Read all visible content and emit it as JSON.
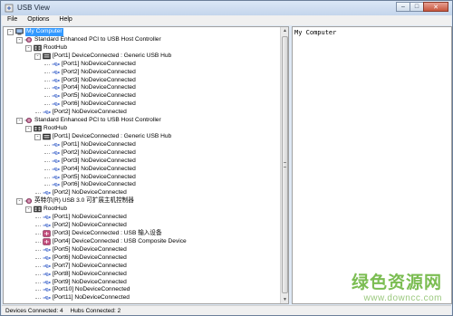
{
  "window": {
    "title": "USB View",
    "buttons": {
      "minimize": "–",
      "maximize": "□",
      "close": "✕"
    }
  },
  "menu": [
    "File",
    "Options",
    "Help"
  ],
  "tree": [
    {
      "level": 0,
      "type": "computer",
      "label": "My Computer",
      "expander": "-",
      "selected": true
    },
    {
      "level": 1,
      "type": "controller",
      "label": "Standard Enhanced PCI to USB Host Controller",
      "expander": "-"
    },
    {
      "level": 2,
      "type": "roothub",
      "label": "RootHub",
      "expander": "-"
    },
    {
      "level": 3,
      "type": "hub",
      "label": "[Port1] DeviceConnected : Generic USB Hub",
      "expander": "-"
    },
    {
      "level": 4,
      "type": "port",
      "label": "[Port1] NoDeviceConnected"
    },
    {
      "level": 4,
      "type": "port",
      "label": "[Port2] NoDeviceConnected"
    },
    {
      "level": 4,
      "type": "port",
      "label": "[Port3] NoDeviceConnected"
    },
    {
      "level": 4,
      "type": "port",
      "label": "[Port4] NoDeviceConnected"
    },
    {
      "level": 4,
      "type": "port",
      "label": "[Port5] NoDeviceConnected"
    },
    {
      "level": 4,
      "type": "port",
      "label": "[Port6] NoDeviceConnected"
    },
    {
      "level": 3,
      "type": "port",
      "label": "[Port2] NoDeviceConnected"
    },
    {
      "level": 1,
      "type": "controller",
      "label": "Standard Enhanced PCI to USB Host Controller",
      "expander": "-"
    },
    {
      "level": 2,
      "type": "roothub",
      "label": "RootHub",
      "expander": "-"
    },
    {
      "level": 3,
      "type": "hub",
      "label": "[Port1] DeviceConnected : Generic USB Hub",
      "expander": "-"
    },
    {
      "level": 4,
      "type": "port",
      "label": "[Port1] NoDeviceConnected"
    },
    {
      "level": 4,
      "type": "port",
      "label": "[Port2] NoDeviceConnected"
    },
    {
      "level": 4,
      "type": "port",
      "label": "[Port3] NoDeviceConnected"
    },
    {
      "level": 4,
      "type": "port",
      "label": "[Port4] NoDeviceConnected"
    },
    {
      "level": 4,
      "type": "port",
      "label": "[Port5] NoDeviceConnected"
    },
    {
      "level": 4,
      "type": "port",
      "label": "[Port6] NoDeviceConnected"
    },
    {
      "level": 3,
      "type": "port",
      "label": "[Port2] NoDeviceConnected"
    },
    {
      "level": 1,
      "type": "controller",
      "label": "英特尔(R) USB 3.0 可扩展主机控制器",
      "expander": "-"
    },
    {
      "level": 2,
      "type": "roothub",
      "label": "RootHub",
      "expander": "-"
    },
    {
      "level": 3,
      "type": "port",
      "label": "[Port1] NoDeviceConnected"
    },
    {
      "level": 3,
      "type": "port",
      "label": "[Port2] NoDeviceConnected"
    },
    {
      "level": 3,
      "type": "device",
      "label": "[Port3] DeviceConnected : USB 输入设备"
    },
    {
      "level": 3,
      "type": "device",
      "label": "[Port4] DeviceConnected : USB Composite Device"
    },
    {
      "level": 3,
      "type": "port",
      "label": "[Port5] NoDeviceConnected"
    },
    {
      "level": 3,
      "type": "port",
      "label": "[Port6] NoDeviceConnected"
    },
    {
      "level": 3,
      "type": "port",
      "label": "[Port7] NoDeviceConnected"
    },
    {
      "level": 3,
      "type": "port",
      "label": "[Port8] NoDeviceConnected"
    },
    {
      "level": 3,
      "type": "port",
      "label": "[Port9] NoDeviceConnected"
    },
    {
      "level": 3,
      "type": "port",
      "label": "[Port10] NoDeviceConnected"
    },
    {
      "level": 3,
      "type": "port",
      "label": "[Port11] NoDeviceConnected"
    }
  ],
  "detail": {
    "text": "My Computer"
  },
  "status": {
    "devices": "Devices Connected: 4",
    "hubs": "Hubs Connected: 2"
  },
  "watermark": {
    "title": "绿色资源网",
    "url": "www.downcc.com"
  },
  "colors": {
    "selection": "#3399ff",
    "port_icon": "#4a6fcf",
    "device_icon": "#b03a6a",
    "watermark": "#7bbd52"
  }
}
